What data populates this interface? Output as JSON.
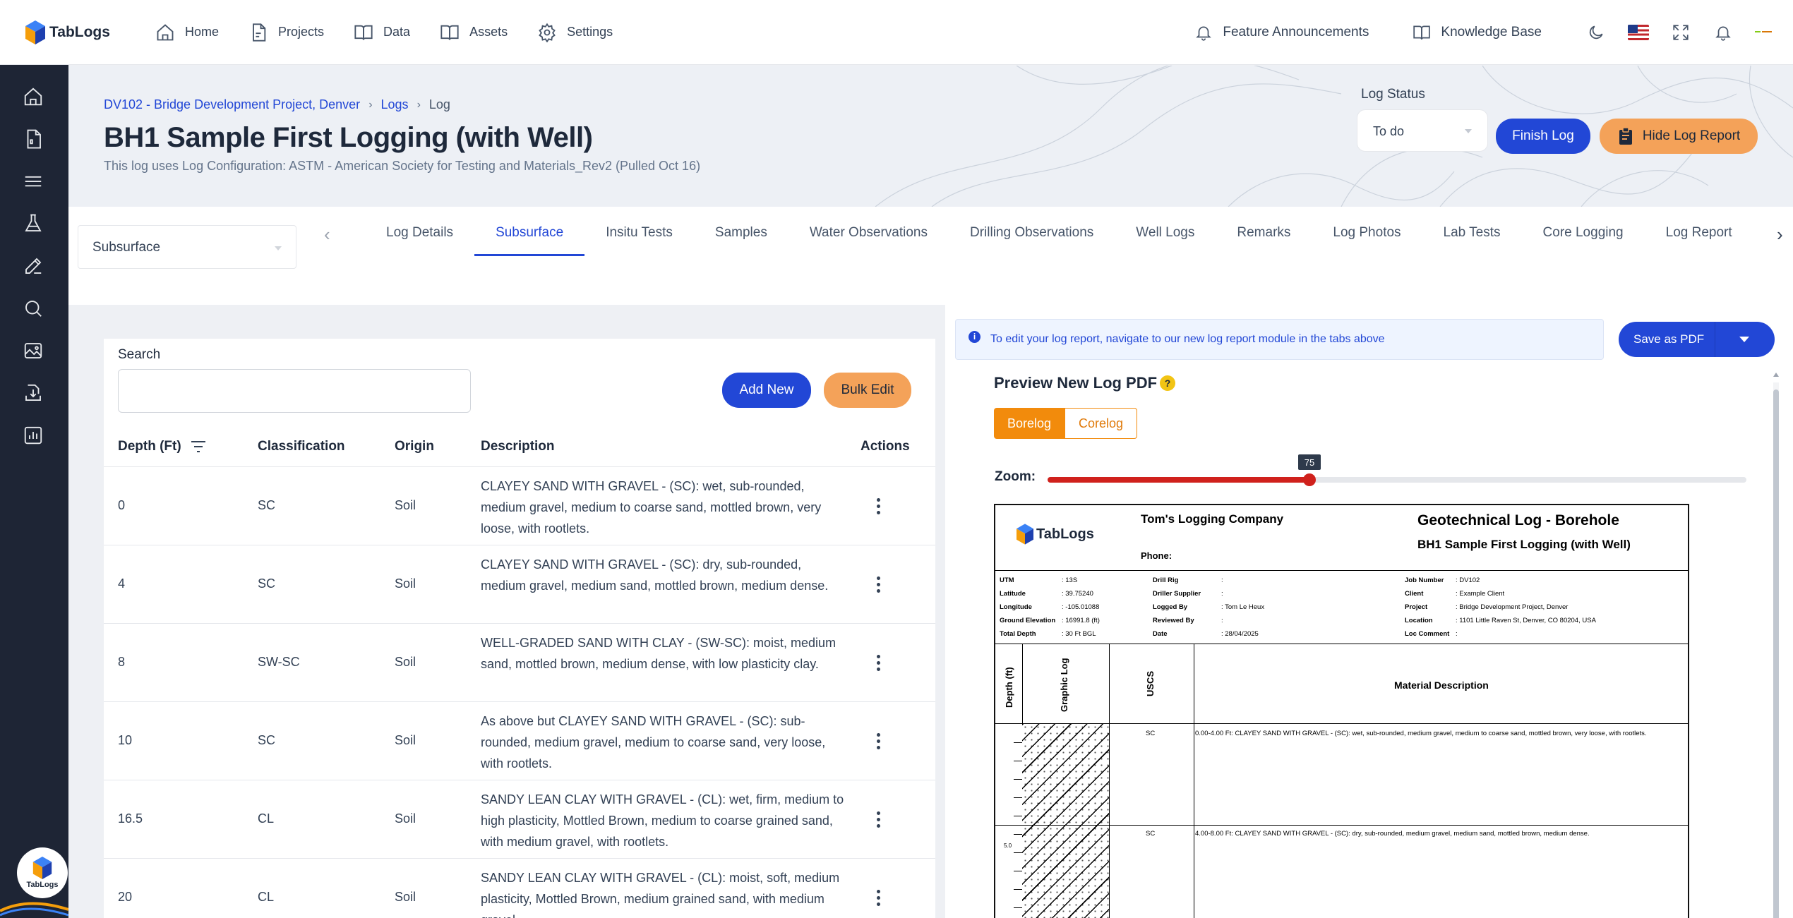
{
  "brand": {
    "name": "TabLogs"
  },
  "nav": {
    "items": [
      {
        "label": "Home",
        "icon": "home-icon"
      },
      {
        "label": "Projects",
        "icon": "document-icon"
      },
      {
        "label": "Data",
        "icon": "book-icon"
      },
      {
        "label": "Assets",
        "icon": "book-icon"
      },
      {
        "label": "Settings",
        "icon": "gear-icon"
      }
    ],
    "feature_announcements": "Feature Announcements",
    "knowledge_base": "Knowledge Base"
  },
  "breadcrumb": {
    "project": "DV102 - Bridge Development Project, Denver",
    "logs": "Logs",
    "current": "Log"
  },
  "page": {
    "title": "BH1 Sample First Logging (with Well)",
    "subtitle": "This log uses Log Configuration: ASTM - American Society for Testing and Materials_Rev2 (Pulled Oct 16)"
  },
  "log_status": {
    "label": "Log Status",
    "value": "To do"
  },
  "actions": {
    "finish": "Finish Log",
    "hide_report": "Hide Log Report"
  },
  "section_select": "Subsurface",
  "tabs": [
    {
      "label": "Log Details",
      "active": false
    },
    {
      "label": "Subsurface",
      "active": true
    },
    {
      "label": "Insitu Tests",
      "active": false
    },
    {
      "label": "Samples",
      "active": false
    },
    {
      "label": "Water Observations",
      "active": false
    },
    {
      "label": "Drilling Observations",
      "active": false
    },
    {
      "label": "Well Logs",
      "active": false
    },
    {
      "label": "Remarks",
      "active": false
    },
    {
      "label": "Log Photos",
      "active": false
    },
    {
      "label": "Lab Tests",
      "active": false
    },
    {
      "label": "Core Logging",
      "active": false
    },
    {
      "label": "Log Report",
      "active": false
    }
  ],
  "subsurface": {
    "search_label": "Search",
    "search_value": "",
    "add_new": "Add New",
    "bulk_edit": "Bulk Edit",
    "columns": {
      "depth": "Depth (Ft)",
      "classification": "Classification",
      "origin": "Origin",
      "description": "Description",
      "actions": "Actions"
    },
    "rows": [
      {
        "depth": "0",
        "classification": "SC",
        "origin": "Soil",
        "description": "CLAYEY SAND WITH GRAVEL - (SC): wet, sub-rounded, medium gravel, medium to coarse sand, mottled brown, very loose, with rootlets."
      },
      {
        "depth": "4",
        "classification": "SC",
        "origin": "Soil",
        "description": "CLAYEY SAND WITH GRAVEL - (SC): dry, sub-rounded, medium gravel, medium sand, mottled brown, medium dense."
      },
      {
        "depth": "8",
        "classification": "SW-SC",
        "origin": "Soil",
        "description": "WELL-GRADED SAND WITH CLAY - (SW-SC): moist, medium sand, mottled brown, medium dense, with low plasticity clay."
      },
      {
        "depth": "10",
        "classification": "SC",
        "origin": "Soil",
        "description": "As above but CLAYEY SAND WITH GRAVEL - (SC): sub-rounded, medium gravel, medium to coarse sand, very loose, with rootlets."
      },
      {
        "depth": "16.5",
        "classification": "CL",
        "origin": "Soil",
        "description": "SANDY LEAN CLAY WITH GRAVEL - (CL): wet, firm, medium to high plasticity, Mottled Brown, medium to coarse grained sand, with medium gravel, with rootlets."
      },
      {
        "depth": "20",
        "classification": "CL",
        "origin": "Soil",
        "description": "SANDY LEAN CLAY WITH GRAVEL - (CL): moist, soft, medium plasticity, Mottled Brown, medium grained sand, with medium gravel"
      }
    ]
  },
  "report": {
    "info": "To edit your log report, navigate to our new log report module in the tabs above",
    "save_pdf": "Save as PDF",
    "preview_title": "Preview New Log PDF",
    "help_badge": "?",
    "borelog": "Borelog",
    "corelog": "Corelog",
    "zoom_label": "Zoom:",
    "zoom_value": 75,
    "zoom_display": "75",
    "doc": {
      "logo_text": "TabLogs",
      "company": "Tom's Logging Company",
      "phone": "Phone:",
      "title": "Geotechnical Log - Borehole",
      "subtitle": "BH1 Sample First Logging (with Well)",
      "meta_col1": [
        {
          "k": "UTM",
          "v": ": 13S"
        },
        {
          "k": "Latitude",
          "v": ": 39.75240"
        },
        {
          "k": "Longitude",
          "v": ": -105.01088"
        },
        {
          "k": "Ground Elevation",
          "v": ": 16991.8 (ft)"
        },
        {
          "k": "Total Depth",
          "v": ": 30 Ft BGL"
        }
      ],
      "meta_col2": [
        {
          "k": "Drill Rig",
          "v": ":"
        },
        {
          "k": "Driller Supplier",
          "v": ":"
        },
        {
          "k": "Logged By",
          "v": ": Tom Le Heux"
        },
        {
          "k": "Reviewed By",
          "v": ":"
        },
        {
          "k": "Date",
          "v": ": 28/04/2025"
        }
      ],
      "meta_col3": [
        {
          "k": "Job Number",
          "v": ": DV102"
        },
        {
          "k": "Client",
          "v": ": Example Client"
        },
        {
          "k": "Project",
          "v": ": Bridge Development Project, Denver"
        },
        {
          "k": "Location",
          "v": ": 1101 Little Raven St, Denver, CO 80204, USA"
        },
        {
          "k": "Loc Comment",
          "v": ":"
        }
      ],
      "col_depth": "Depth (ft)",
      "col_graphic": "Graphic Log",
      "col_uscs": "USCS",
      "col_material": "Material Description",
      "layers": [
        {
          "uscs": "SC",
          "text": "0.00-4.00 Ft: CLAYEY SAND WITH GRAVEL - (SC): wet, sub-rounded, medium gravel, medium to coarse sand, mottled brown, very loose, with rootlets."
        },
        {
          "uscs": "SC",
          "text": "4.00-8.00 Ft: CLAYEY SAND WITH GRAVEL - (SC): dry, sub-rounded, medium gravel, medium sand, mottled brown, medium dense."
        }
      ],
      "depth_tick": "5.0"
    }
  },
  "colors": {
    "primary": "#2247d6",
    "accent": "#f4a259",
    "sidebar": "#1e2535",
    "orange": "#f28b0c",
    "slider": "#d0211c"
  }
}
